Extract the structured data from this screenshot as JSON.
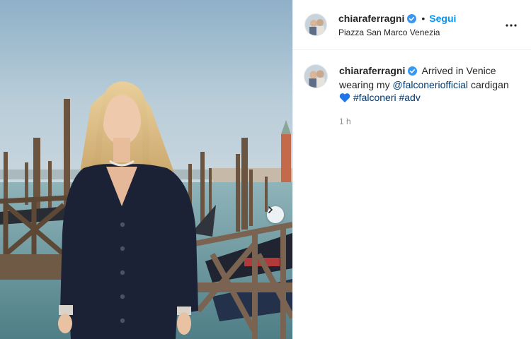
{
  "post": {
    "author": {
      "username": "chiaraferragni",
      "verified": true,
      "follow_label": "Segui",
      "location": "Piazza San Marco Venezia"
    },
    "caption": {
      "username": "chiaraferragni",
      "text_before": "Arrived in Venice wearing my",
      "mention": "@falconeriofficial",
      "text_after": "cardigan",
      "emoji": "blue-heart",
      "hashtags": [
        "#falconeri",
        "#adv"
      ]
    },
    "time_ago": "1 h",
    "colors": {
      "follow_blue": "#0095f6",
      "link_blue": "#00376b",
      "verified_blue": "#3897f0",
      "muted": "#8e8e8e"
    },
    "icons": {
      "verified": "verified-badge-icon",
      "more": "more-options-icon",
      "next": "chevron-right-icon",
      "heart": "blue-heart-icon"
    }
  }
}
